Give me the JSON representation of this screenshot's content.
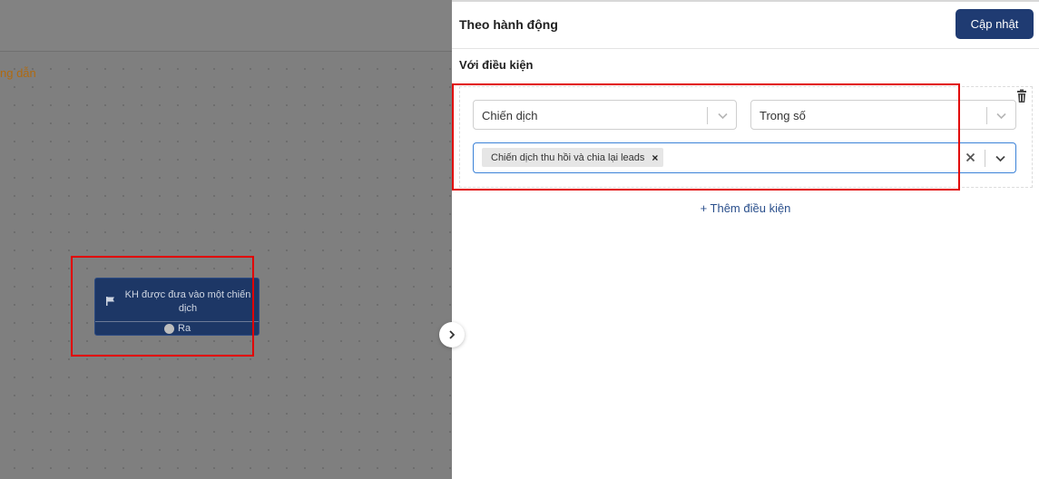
{
  "canvas": {
    "hint_text": "ng dẫn",
    "node": {
      "icon": "flag-icon",
      "title": "KH được đưa vào một chiến dịch",
      "port_label": "Ra"
    }
  },
  "panel": {
    "title": "Theo hành động",
    "update_label": "Cập nhật",
    "conditions_heading": "Với điều kiện",
    "condition": {
      "field_select": "Chiến dịch",
      "operator_select": "Trong số",
      "selected_values": [
        "Chiến dịch thu hồi và chia lại leads"
      ]
    },
    "add_condition_label": "+ Thêm điều kiện"
  },
  "colors": {
    "primary": "#1f3b72",
    "node_bg": "#1d3766",
    "highlight": "#e10000",
    "focus_border": "#3b82d8",
    "link": "#2a4f8c"
  }
}
